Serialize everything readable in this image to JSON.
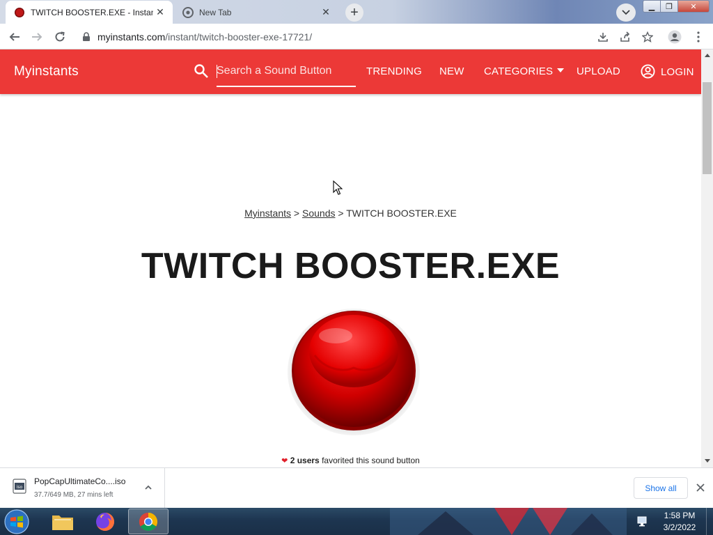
{
  "browser": {
    "tabs": [
      {
        "title": "TWITCH BOOSTER.EXE - Instant S",
        "active": true
      },
      {
        "title": "New Tab",
        "active": false
      }
    ],
    "url_domain": "myinstants.com",
    "url_path": "/instant/twitch-booster-exe-17721/"
  },
  "site": {
    "logo": "Myinstants",
    "search_placeholder": "Search a Sound Button",
    "nav": {
      "trending": "TRENDING",
      "new": "NEW",
      "categories": "CATEGORIES",
      "upload": "UPLOAD",
      "login": "LOGIN"
    },
    "accent_color": "#ec3937"
  },
  "page": {
    "breadcrumb": {
      "home": "Myinstants",
      "sep1": ">",
      "sounds": "Sounds",
      "sep2": ">",
      "current": "TWITCH BOOSTER.EXE"
    },
    "title": "TWITCH BOOSTER.EXE",
    "favorites": {
      "count_text": "2 users",
      "suffix": "favorited this sound button"
    }
  },
  "downloads": {
    "file_name": "PopCapUltimateCo....iso",
    "status": "37.7/649 MB, 27 mins left",
    "show_all": "Show all"
  },
  "taskbar": {
    "time": "1:58 PM",
    "date": "3/2/2022",
    "apps": [
      "file-explorer",
      "firefox",
      "chrome"
    ]
  }
}
